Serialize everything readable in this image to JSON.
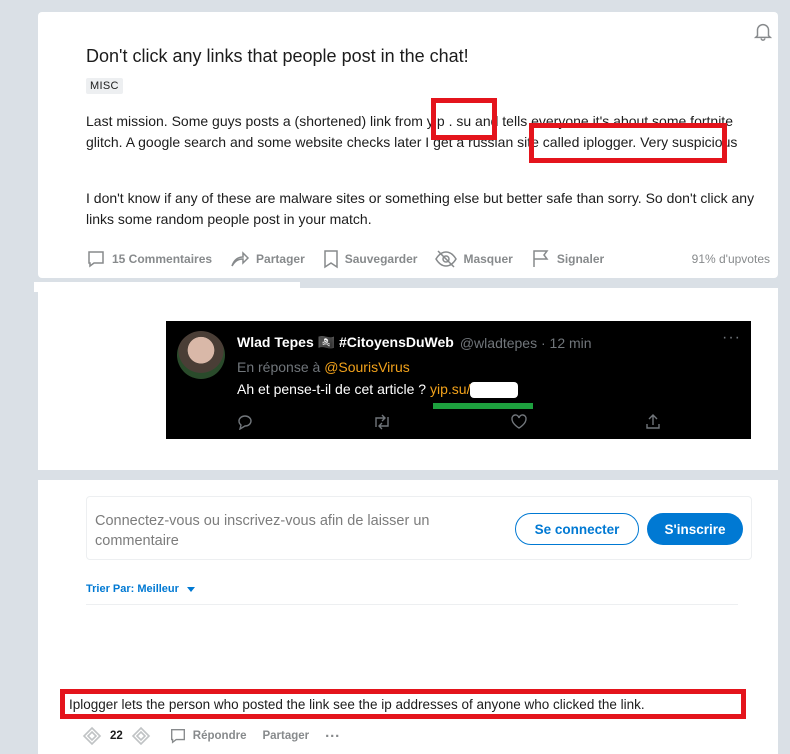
{
  "post": {
    "title": "Don't click any links that people post in the chat!",
    "flair": "MISC",
    "paragraph1": "Last mission. Some guys posts a (shortened) link from yip . su and tells everyone it's about some fortnite glitch. A google search and some website checks later I get a russian site called iplogger. Very suspicious",
    "paragraph2": "I don't know if any of these are malware sites or something else but better safe than sorry. So don't click any links some random people post in your match.",
    "actions": {
      "comments": "15 Commentaires",
      "share": "Partager",
      "save": "Sauvegarder",
      "hide": "Masquer",
      "report": "Signaler"
    },
    "upvotes": "91% d'upvotes"
  },
  "tweet": {
    "name": "Wlad Tepes 🏴‍☠️ #CitoyensDuWeb",
    "handle": "@wladtepes · 12 min",
    "reply_prefix": "En réponse à",
    "reply_to": "@SourisVirus",
    "text": "Ah et pense-t-il de cet article ?",
    "link": "yip.su/",
    "more": "···"
  },
  "comments": {
    "login_prompt": "Connectez-vous ou inscrivez-vous afin de laisser un commentaire",
    "login_button": "Se connecter",
    "signup_button": "S'inscrire",
    "sort_label": "Trier Par: Meilleur",
    "comment_text": "Iplogger lets the person who posted the link see the ip addresses of anyone who clicked the link.",
    "comment_votes": "22",
    "reply": "Répondre",
    "share": "Partager",
    "more": "···"
  },
  "colors": {
    "highlight_red": "#e4141c",
    "reddit_blue": "#0079d3",
    "link_orange": "#f2a21b"
  }
}
